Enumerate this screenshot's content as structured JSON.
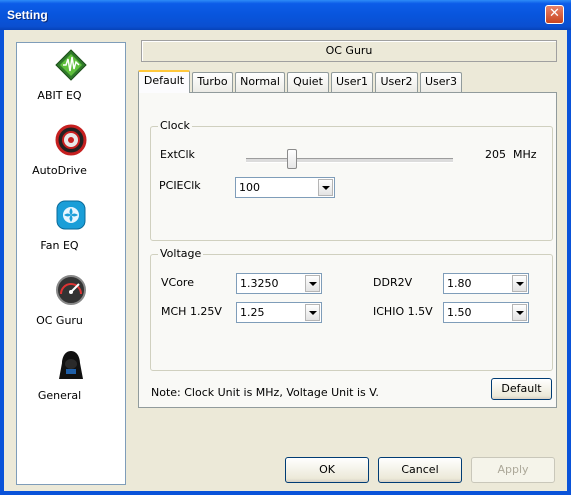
{
  "window": {
    "title": "Setting"
  },
  "sidebar": {
    "items": [
      {
        "label": "ABIT EQ",
        "icon": "abit-eq-icon"
      },
      {
        "label": "AutoDrive",
        "icon": "autodrive-icon"
      },
      {
        "label": "Fan EQ",
        "icon": "fan-eq-icon"
      },
      {
        "label": "OC Guru",
        "icon": "oc-guru-icon"
      },
      {
        "label": "General",
        "icon": "general-icon"
      }
    ]
  },
  "panel": {
    "title": "OC Guru",
    "tabs": [
      "Default",
      "Turbo",
      "Normal",
      "Quiet",
      "User1",
      "User2",
      "User3"
    ],
    "active_tab": "Default"
  },
  "clock": {
    "legend": "Clock",
    "extclk_label": "ExtClk",
    "extclk_value": "205",
    "extclk_unit": "MHz",
    "pcieclk_label": "PCIEClk",
    "pcieclk_value": "100"
  },
  "voltage": {
    "legend": "Voltage",
    "vcore_label": "VCore",
    "vcore_value": "1.3250",
    "ddr2v_label": "DDR2V",
    "ddr2v_value": "1.80",
    "mch_label": "MCH 1.25V",
    "mch_value": "1.25",
    "ichio_label": "ICHIO 1.5V",
    "ichio_value": "1.50"
  },
  "note": "Note: Clock Unit is MHz, Voltage Unit is V.",
  "buttons": {
    "default": "Default",
    "ok": "OK",
    "cancel": "Cancel",
    "apply": "Apply"
  },
  "colors": {
    "titlebar": "#0a53d9",
    "tab_highlight": "#ffc83c",
    "close": "#c9451f"
  }
}
